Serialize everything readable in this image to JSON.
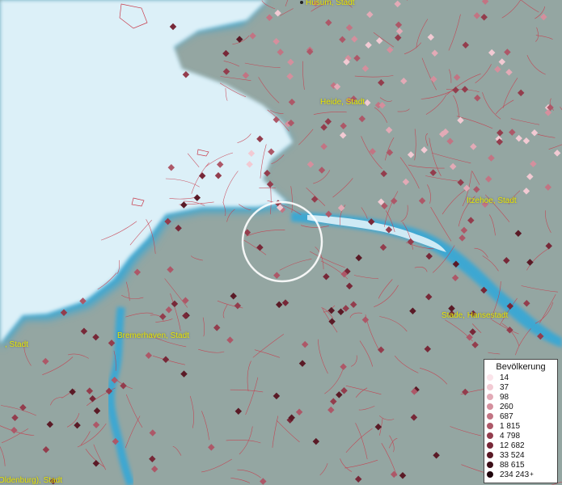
{
  "map": {
    "cities": [
      {
        "id": "husum",
        "label": "Husum, Stadt"
      },
      {
        "id": "heide",
        "label": "Heide, Stadt"
      },
      {
        "id": "itzehoe",
        "label": "Itzehoe, Stadt"
      },
      {
        "id": "stade",
        "label": "Stade, Hansestadt"
      },
      {
        "id": "bremerhaven",
        "label": "Bremerhaven, Stadt"
      },
      {
        "id": "oldenburg",
        "label": "Oldenburg), Stadt"
      },
      {
        "id": "west",
        "label": ", Stadt"
      }
    ],
    "colors": {
      "water": "#daeef6",
      "land": "#95a7a4",
      "borders": "#c83a4a",
      "river": "#3aa0c8",
      "label": "#e8e800"
    }
  },
  "legend": {
    "title": "Bevölkerung",
    "entries": [
      {
        "label": "14",
        "color": "#fbe4ea"
      },
      {
        "label": "37",
        "color": "#f2cad3"
      },
      {
        "label": "98",
        "color": "#e2aab6"
      },
      {
        "label": "260",
        "color": "#d48f9d"
      },
      {
        "label": "687",
        "color": "#c27483"
      },
      {
        "label": "1 815",
        "color": "#ad5868"
      },
      {
        "label": "4 798",
        "color": "#933d4d"
      },
      {
        "label": "12 682",
        "color": "#772838"
      },
      {
        "label": "33 524",
        "color": "#5a1a26"
      },
      {
        "label": "88 615",
        "color": "#3c0f18"
      },
      {
        "label": "234 243",
        "color": "#1e050b",
        "plus": "+"
      }
    ]
  }
}
